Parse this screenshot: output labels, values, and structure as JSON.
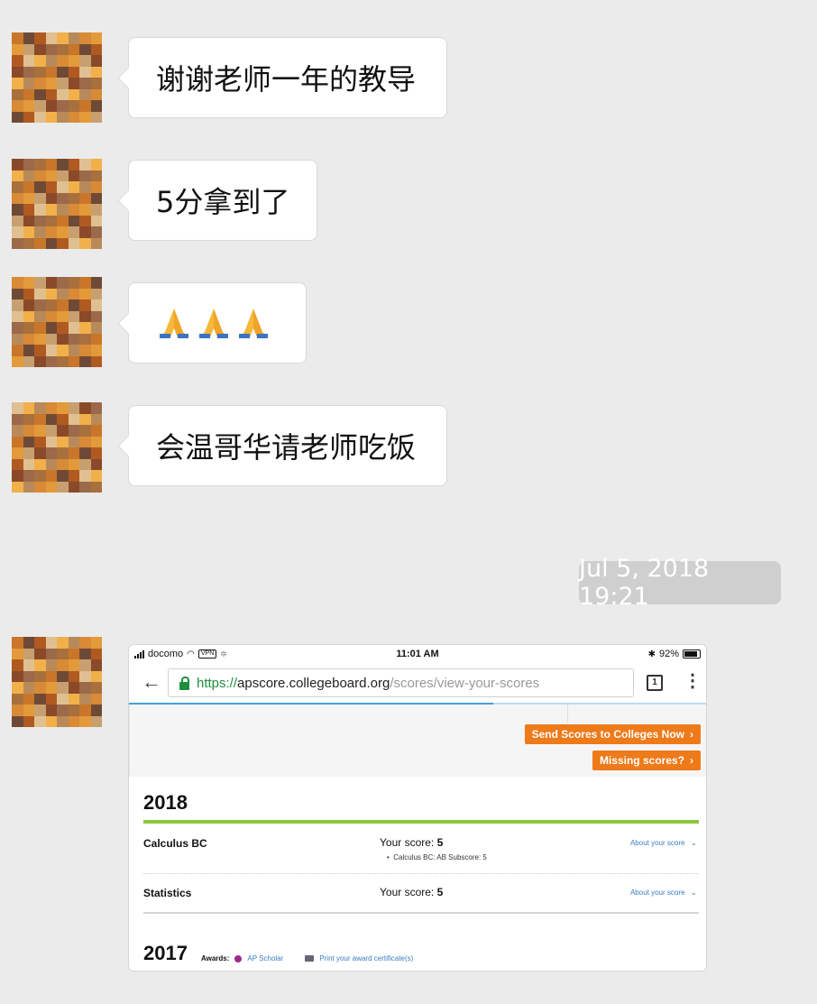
{
  "messages": [
    {
      "text": "谢谢老师一年的教导"
    },
    {
      "text": "5分拿到了"
    },
    {
      "text": "🙏🙏🙏"
    },
    {
      "text": "会温哥华请老师吃饭"
    }
  ],
  "timestamp": "Jul 5, 2018 19:21",
  "screenshot": {
    "status_bar": {
      "carrier": "docomo",
      "vpn": "VPN",
      "time": "11:01 AM",
      "battery": "92%"
    },
    "url": {
      "scheme": "https://",
      "host": "apscore.collegeboard.org",
      "path": "/scores/view-your-scores"
    },
    "tab_count": "1",
    "buttons": {
      "send_scores": "Send Scores to Colleges Now",
      "missing_scores": "Missing scores?"
    },
    "year_2018": "2018",
    "scores": [
      {
        "subject": "Calculus BC",
        "score_label": "Your score: ",
        "score": "5",
        "subscore": "Calculus BC: AB Subscore: 5",
        "about": "About your score"
      },
      {
        "subject": "Statistics",
        "score_label": "Your score: ",
        "score": "5",
        "about": "About your score"
      }
    ],
    "year_2017": "2017",
    "awards_label": "Awards:",
    "award": "AP Scholar",
    "print_link": "Print your award certificate(s)"
  },
  "colors": {
    "background": "#ebebeb",
    "bubble": "#ffffff",
    "timestamp_bg": "#cfcfcf",
    "accent_orange": "#ee7a1a",
    "accent_green": "#8cc63f",
    "link_blue": "#3a7cc4"
  }
}
